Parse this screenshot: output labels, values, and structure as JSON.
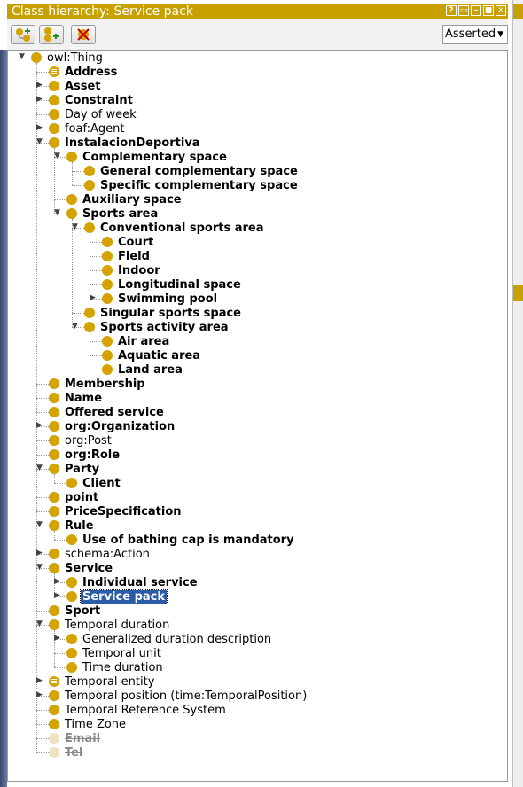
{
  "window": {
    "title": "Class hierarchy: Service pack"
  },
  "title_controls": [
    "?",
    "▭",
    "–",
    "■",
    "✕"
  ],
  "toolbar": {
    "view_mode": "Asserted"
  },
  "tree": [
    {
      "label": "owl:Thing",
      "level": 0,
      "expander": "expanded",
      "bold": false
    },
    {
      "label": "Address",
      "level": 1,
      "expander": "none",
      "bold": true,
      "icon": "defined"
    },
    {
      "label": "Asset",
      "level": 1,
      "expander": "collapsed",
      "bold": true
    },
    {
      "label": "Constraint",
      "level": 1,
      "expander": "collapsed",
      "bold": true
    },
    {
      "label": "Day of week",
      "level": 1,
      "expander": "none",
      "bold": false
    },
    {
      "label": "foaf:Agent",
      "level": 1,
      "expander": "collapsed",
      "bold": false
    },
    {
      "label": "InstalacionDeportiva",
      "level": 1,
      "expander": "expanded",
      "bold": true
    },
    {
      "label": "Complementary space",
      "level": 2,
      "expander": "expanded",
      "bold": true
    },
    {
      "label": "General complementary space",
      "level": 3,
      "expander": "none",
      "bold": true
    },
    {
      "label": "Specific complementary space",
      "level": 3,
      "expander": "none",
      "bold": true
    },
    {
      "label": "Auxiliary space",
      "level": 2,
      "expander": "none",
      "bold": true
    },
    {
      "label": "Sports area",
      "level": 2,
      "expander": "expanded",
      "bold": true
    },
    {
      "label": "Conventional sports area",
      "level": 3,
      "expander": "expanded",
      "bold": true
    },
    {
      "label": "Court",
      "level": 4,
      "expander": "none",
      "bold": true
    },
    {
      "label": "Field",
      "level": 4,
      "expander": "none",
      "bold": true
    },
    {
      "label": "Indoor",
      "level": 4,
      "expander": "none",
      "bold": true
    },
    {
      "label": "Longitudinal space",
      "level": 4,
      "expander": "none",
      "bold": true
    },
    {
      "label": "Swimming pool",
      "level": 4,
      "expander": "collapsed",
      "bold": true
    },
    {
      "label": "Singular sports space",
      "level": 3,
      "expander": "none",
      "bold": true
    },
    {
      "label": "Sports activity area",
      "level": 3,
      "expander": "expanded",
      "bold": true
    },
    {
      "label": "Air area",
      "level": 4,
      "expander": "none",
      "bold": true
    },
    {
      "label": "Aquatic area",
      "level": 4,
      "expander": "none",
      "bold": true
    },
    {
      "label": "Land area",
      "level": 4,
      "expander": "none",
      "bold": true
    },
    {
      "label": "Membership",
      "level": 1,
      "expander": "none",
      "bold": true
    },
    {
      "label": "Name",
      "level": 1,
      "expander": "none",
      "bold": true
    },
    {
      "label": "Offered service",
      "level": 1,
      "expander": "none",
      "bold": true
    },
    {
      "label": "org:Organization",
      "level": 1,
      "expander": "collapsed",
      "bold": true
    },
    {
      "label": "org:Post",
      "level": 1,
      "expander": "none",
      "bold": false
    },
    {
      "label": "org:Role",
      "level": 1,
      "expander": "none",
      "bold": true
    },
    {
      "label": "Party",
      "level": 1,
      "expander": "expanded",
      "bold": true
    },
    {
      "label": "Client",
      "level": 2,
      "expander": "none",
      "bold": true
    },
    {
      "label": "point",
      "level": 1,
      "expander": "none",
      "bold": true
    },
    {
      "label": "PriceSpecification",
      "level": 1,
      "expander": "none",
      "bold": true
    },
    {
      "label": "Rule",
      "level": 1,
      "expander": "expanded",
      "bold": true
    },
    {
      "label": "Use of bathing cap is mandatory",
      "level": 2,
      "expander": "none",
      "bold": true
    },
    {
      "label": "schema:Action",
      "level": 1,
      "expander": "collapsed",
      "bold": false
    },
    {
      "label": "Service",
      "level": 1,
      "expander": "expanded",
      "bold": true
    },
    {
      "label": "Individual service",
      "level": 2,
      "expander": "collapsed",
      "bold": true
    },
    {
      "label": "Service pack",
      "level": 2,
      "expander": "collapsed",
      "bold": true,
      "selected": true
    },
    {
      "label": "Sport",
      "level": 1,
      "expander": "none",
      "bold": true
    },
    {
      "label": "Temporal duration",
      "level": 1,
      "expander": "expanded",
      "bold": false
    },
    {
      "label": "Generalized duration description",
      "level": 2,
      "expander": "collapsed",
      "bold": false
    },
    {
      "label": "Temporal unit",
      "level": 2,
      "expander": "none",
      "bold": false
    },
    {
      "label": "Time duration",
      "level": 2,
      "expander": "none",
      "bold": false
    },
    {
      "label": "Temporal entity",
      "level": 1,
      "expander": "collapsed",
      "bold": false,
      "icon": "defined"
    },
    {
      "label": "Temporal position (time:TemporalPosition)",
      "level": 1,
      "expander": "collapsed",
      "bold": false
    },
    {
      "label": "Temporal Reference System",
      "level": 1,
      "expander": "none",
      "bold": false
    },
    {
      "label": "Time Zone",
      "level": 1,
      "expander": "none",
      "bold": false
    },
    {
      "label": "Email",
      "level": 1,
      "expander": "none",
      "deprecated": true
    },
    {
      "label": "Tel",
      "level": 1,
      "expander": "none",
      "deprecated": true
    }
  ]
}
